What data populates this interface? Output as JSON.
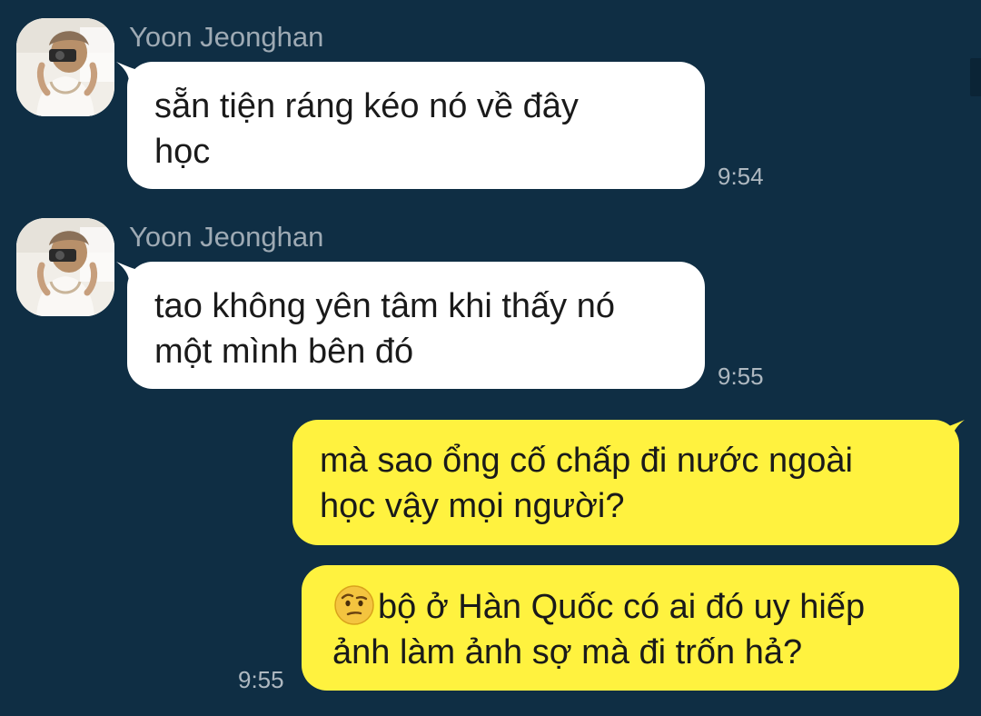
{
  "messages": [
    {
      "sender": "Yoon Jeonghan",
      "lines": [
        "sẵn tiện ráng kéo nó về đây",
        "học"
      ],
      "time": "9:54",
      "direction": "incoming"
    },
    {
      "sender": "Yoon Jeonghan",
      "lines": [
        "tao không yên tâm khi thấy nó",
        "một mình bên đó"
      ],
      "time": "9:55",
      "direction": "incoming"
    },
    {
      "lines": [
        "mà sao ổng cố chấp đi nước ngoài",
        "học vậy mọi người?"
      ],
      "direction": "outgoing"
    },
    {
      "emoji": "face-with-raised-eyebrow-icon",
      "lines": [
        "bộ ở Hàn Quốc có ai đó uy hiếp",
        "ảnh làm ảnh sợ mà đi trốn hả?"
      ],
      "time": "9:55",
      "direction": "outgoing"
    }
  ],
  "colors": {
    "background": "#0f2e44",
    "incoming_bubble": "#ffffff",
    "outgoing_bubble": "#fff23f",
    "sender_name": "#9eaab4",
    "timestamp": "#aeb8c0"
  }
}
